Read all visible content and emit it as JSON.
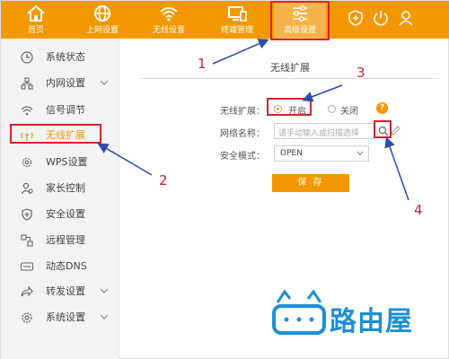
{
  "nav": {
    "items": [
      {
        "label": "首页",
        "icon": "home-icon"
      },
      {
        "label": "上网设置",
        "icon": "globe-icon"
      },
      {
        "label": "无线设置",
        "icon": "wifi-icon"
      },
      {
        "label": "终端管理",
        "icon": "monitor-icon"
      },
      {
        "label": "高级设置",
        "icon": "sliders-icon"
      }
    ],
    "active_index": 4,
    "right_icons": [
      "shield-plus-icon",
      "power-icon",
      "user-icon"
    ]
  },
  "sidebar": {
    "items": [
      {
        "label": "系统状态",
        "icon": "clock-icon",
        "expandable": false
      },
      {
        "label": "内网设置",
        "icon": "network-icon",
        "expandable": true
      },
      {
        "label": "信号调节",
        "icon": "signal-icon",
        "expandable": false
      },
      {
        "label": "无线扩展",
        "icon": "wireless-extend-icon",
        "expandable": false
      },
      {
        "label": "WPS设置",
        "icon": "gear-icon",
        "expandable": false
      },
      {
        "label": "家长控制",
        "icon": "parent-icon",
        "expandable": false
      },
      {
        "label": "安全设置",
        "icon": "shield-icon",
        "expandable": false
      },
      {
        "label": "远程管理",
        "icon": "remote-icon",
        "expandable": false
      },
      {
        "label": "动态DNS",
        "icon": "dns-icon",
        "expandable": false
      },
      {
        "label": "转发设置",
        "icon": "forward-icon",
        "expandable": true
      },
      {
        "label": "系统设置",
        "icon": "system-gear-icon",
        "expandable": true
      }
    ],
    "active_index": 3
  },
  "main": {
    "title": "无线扩展",
    "extend_label": "无线扩展：",
    "option_on": "开启",
    "option_off": "关闭",
    "selected": "开启",
    "help": "?",
    "ssid_label": "网络名称：",
    "ssid_placeholder": "请手动输入或扫描选择",
    "security_label": "安全模式：",
    "security_value": "OPEN",
    "save_label": "保 存"
  },
  "annotations": {
    "numbers": [
      "1",
      "2",
      "3",
      "4"
    ]
  },
  "watermark": {
    "text": "路由屋"
  },
  "colors": {
    "brand": "#f39800",
    "callout": "#d9232d",
    "arrow": "#2f4aa8",
    "watermark": "#1e8fd5"
  }
}
